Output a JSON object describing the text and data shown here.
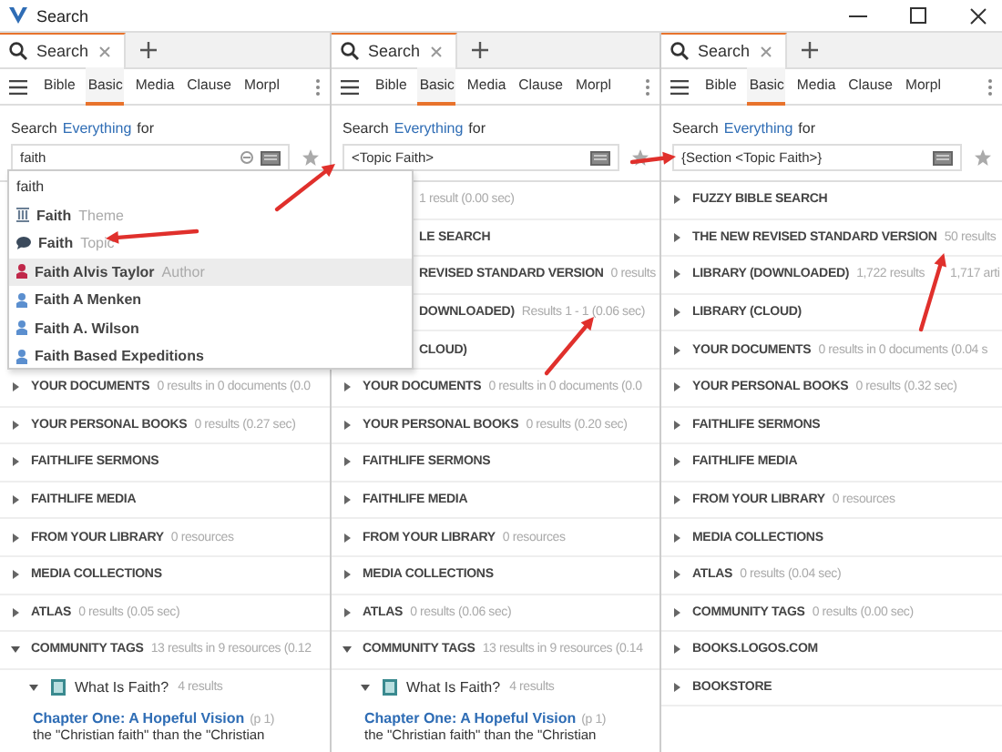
{
  "window": {
    "title": "Search"
  },
  "panels": [
    {
      "tab": {
        "label": "Search",
        "selected": true
      },
      "toolbar": [
        {
          "label": "Bible",
          "selected": false
        },
        {
          "label": "Basic",
          "selected": true
        },
        {
          "label": "Media",
          "selected": false
        },
        {
          "label": "Clause",
          "selected": false
        },
        {
          "label": "Morpl",
          "selected": false
        }
      ],
      "prompt": {
        "before": "Search",
        "scope": "Everything",
        "after": "for"
      },
      "query": {
        "value": "faith",
        "clear_button": true
      },
      "suggestions": [
        {
          "kind": "text",
          "label": "faith",
          "selected": false
        },
        {
          "kind": "theme",
          "label": "Faith",
          "type": "Theme",
          "selected": false
        },
        {
          "kind": "topic",
          "label": "Faith",
          "type": "Topic",
          "selected": false
        },
        {
          "kind": "author",
          "label": "Faith Alvis Taylor",
          "type": "Author",
          "selected": true
        },
        {
          "kind": "person",
          "label": "Faith A Menken",
          "selected": false
        },
        {
          "kind": "person",
          "label": "Faith A. Wilson",
          "selected": false
        },
        {
          "kind": "person",
          "label": "Faith Based Expeditions",
          "selected": false
        }
      ],
      "results": [
        {
          "title": "YOUR DOCUMENTS",
          "meta": [
            "0 results in 0 documents (0.0"
          ],
          "expanded": false
        },
        {
          "title": "YOUR PERSONAL BOOKS",
          "meta": [
            "0 results (0.27 sec)"
          ],
          "expanded": false
        },
        {
          "title": "FAITHLIFE SERMONS",
          "expanded": false
        },
        {
          "title": "FAITHLIFE MEDIA",
          "expanded": false
        },
        {
          "title": "FROM YOUR LIBRARY",
          "meta": [
            "0 resources"
          ],
          "expanded": false
        },
        {
          "title": "MEDIA COLLECTIONS",
          "expanded": false
        },
        {
          "title": "ATLAS",
          "meta": [
            "0 results (0.05 sec)"
          ],
          "expanded": false
        },
        {
          "title": "COMMUNITY TAGS",
          "meta": [
            "13 results in 9 resources (0.12"
          ],
          "expanded": true,
          "children": [
            {
              "title": "What Is Faith?",
              "meta": "4 results",
              "expanded": true,
              "hits": [
                {
                  "link": "Chapter One: A Hopeful Vision",
                  "page": "(p 1)",
                  "snippet": "the \"Christian faith\" than the \"Christian"
                }
              ]
            }
          ]
        }
      ]
    },
    {
      "tab": {
        "label": "Search",
        "selected": true
      },
      "toolbar": [
        {
          "label": "Bible",
          "selected": false
        },
        {
          "label": "Basic",
          "selected": true
        },
        {
          "label": "Media",
          "selected": false
        },
        {
          "label": "Clause",
          "selected": false
        },
        {
          "label": "Morpl",
          "selected": false
        }
      ],
      "prompt": {
        "before": "Search",
        "scope": "Everything",
        "after": "for"
      },
      "query": {
        "value": "<Topic Faith>",
        "clear_button": false
      },
      "results_behind_dropdown": [
        {
          "meta": "1 result (0.00 sec)"
        },
        {
          "title": "LE SEARCH"
        },
        {
          "title": "REVISED STANDARD VERSION",
          "meta": "0 results"
        },
        {
          "title": "DOWNLOADED)",
          "meta": "Results 1 - 1 (0.06 sec)"
        },
        {
          "title": "CLOUD)"
        }
      ],
      "results": [
        {
          "title": "YOUR DOCUMENTS",
          "meta": [
            "0 results in 0 documents (0.0"
          ],
          "expanded": false
        },
        {
          "title": "YOUR PERSONAL BOOKS",
          "meta": [
            "0 results (0.20 sec)"
          ],
          "expanded": false
        },
        {
          "title": "FAITHLIFE SERMONS",
          "expanded": false
        },
        {
          "title": "FAITHLIFE MEDIA",
          "expanded": false
        },
        {
          "title": "FROM YOUR LIBRARY",
          "meta": [
            "0 resources"
          ],
          "expanded": false
        },
        {
          "title": "MEDIA COLLECTIONS",
          "expanded": false
        },
        {
          "title": "ATLAS",
          "meta": [
            "0 results (0.06 sec)"
          ],
          "expanded": false
        },
        {
          "title": "COMMUNITY TAGS",
          "meta": [
            "13 results in 9 resources (0.14"
          ],
          "expanded": true,
          "children": [
            {
              "title": "What Is Faith?",
              "meta": "4 results",
              "expanded": true,
              "hits": [
                {
                  "link": "Chapter One: A Hopeful Vision",
                  "page": "(p 1)",
                  "snippet": "the \"Christian faith\" than the \"Christian"
                }
              ]
            }
          ]
        }
      ]
    },
    {
      "tab": {
        "label": "Search",
        "selected": true
      },
      "toolbar": [
        {
          "label": "Bible",
          "selected": false
        },
        {
          "label": "Basic",
          "selected": true
        },
        {
          "label": "Media",
          "selected": false
        },
        {
          "label": "Clause",
          "selected": false
        },
        {
          "label": "Morpl",
          "selected": false
        }
      ],
      "prompt": {
        "before": "Search",
        "scope": "Everything",
        "after": "for"
      },
      "query": {
        "value": "{Section <Topic Faith>}",
        "clear_button": false
      },
      "results": [
        {
          "title": "FUZZY BIBLE SEARCH",
          "expanded": false
        },
        {
          "title": "THE NEW REVISED STANDARD VERSION",
          "meta": [
            "50 results"
          ],
          "expanded": false
        },
        {
          "title": "LIBRARY (DOWNLOADED)",
          "meta": [
            "1,722 results",
            "1,717 arti"
          ],
          "expanded": false
        },
        {
          "title": "LIBRARY (CLOUD)",
          "expanded": false
        },
        {
          "title": "YOUR DOCUMENTS",
          "meta": [
            "0 results in 0 documents (0.04 s"
          ],
          "expanded": false
        },
        {
          "title": "YOUR PERSONAL BOOKS",
          "meta": [
            "0 results (0.32 sec)"
          ],
          "expanded": false
        },
        {
          "title": "FAITHLIFE SERMONS",
          "expanded": false
        },
        {
          "title": "FAITHLIFE MEDIA",
          "expanded": false
        },
        {
          "title": "FROM YOUR LIBRARY",
          "meta": [
            "0 resources"
          ],
          "expanded": false
        },
        {
          "title": "MEDIA COLLECTIONS",
          "expanded": false
        },
        {
          "title": "ATLAS",
          "meta": [
            "0 results (0.04 sec)"
          ],
          "expanded": false
        },
        {
          "title": "COMMUNITY TAGS",
          "meta": [
            "0 results (0.00 sec)"
          ],
          "expanded": false
        },
        {
          "title": "BOOKS.LOGOS.COM",
          "expanded": false
        },
        {
          "title": "BOOKSTORE",
          "expanded": false
        }
      ]
    }
  ]
}
